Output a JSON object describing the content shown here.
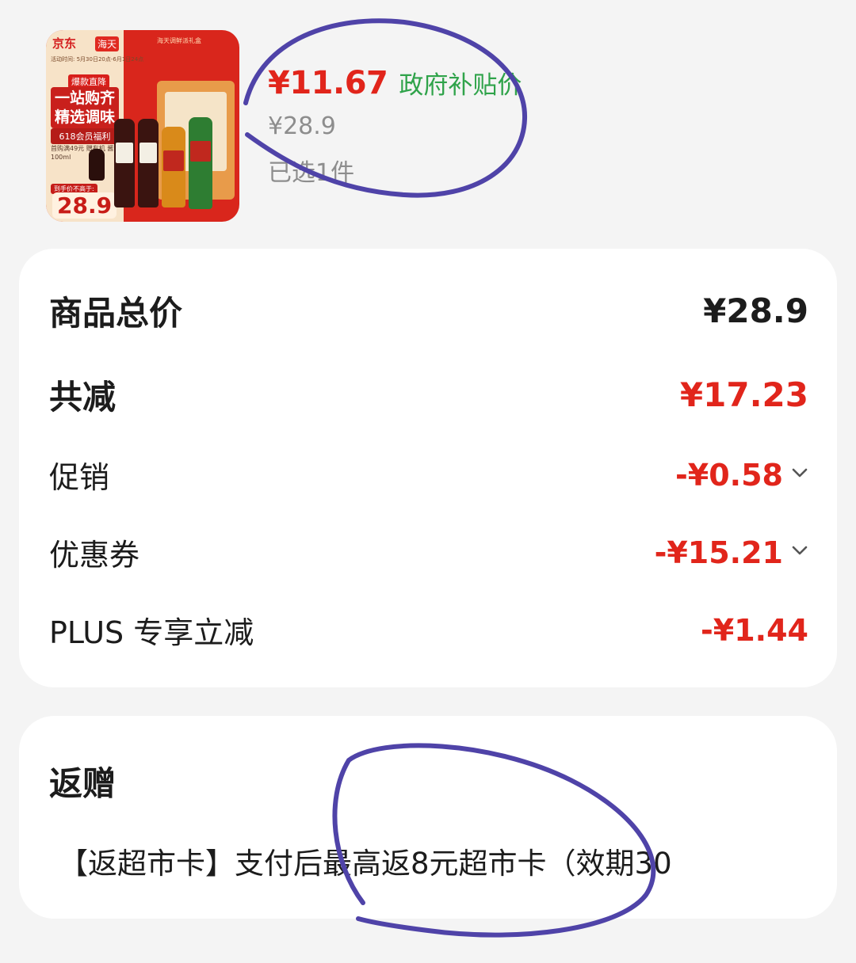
{
  "product": {
    "image": {
      "brand": "京东",
      "brand2": "海天",
      "dates": "活动时间: 5月30日20点-6月1日24点",
      "tag": "爆款直降",
      "slogan": "一站购齐 精选调味",
      "fuli": "618会员福利",
      "small": "首购满49元 赠有机 酱油100ml",
      "pricebar": "到手价不高于:",
      "bigprice": "28.9",
      "gift_title": "海天调鲜派礼盒"
    },
    "sale_price": "¥11.67",
    "subsidy_label": "政府补贴价",
    "original_price": "¥28.9",
    "selected_count": "已选1件"
  },
  "price_summary": {
    "total_label": "商品总价",
    "total_value": "¥28.9",
    "reduce_label": "共减",
    "reduce_value": "¥17.23",
    "promo_label": "促销",
    "promo_value": "-¥0.58",
    "coupon_label": "优惠券",
    "coupon_value": "-¥15.21",
    "plus_label": "PLUS 专享立减",
    "plus_value": "-¥1.44"
  },
  "rebate": {
    "title": "返赠",
    "text": "【返超市卡】支付后最高返8元超市卡（效期30"
  },
  "colors": {
    "accent_red": "#e1251b",
    "subsidy_green": "#2fa34a",
    "muted_gray": "#8d8d8d",
    "annotation_purple": "#4f43a8"
  },
  "icons": {
    "dropdown": "chevron-down-icon"
  }
}
